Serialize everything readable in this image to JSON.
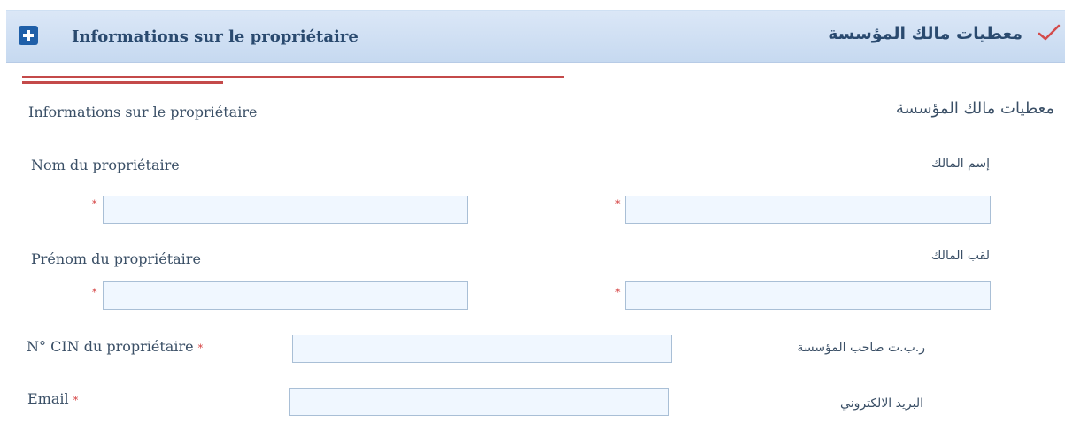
{
  "header": {
    "title_fr": "Informations sur le propriétaire",
    "title_ar": "معطيات مالك المؤسسة",
    "left_icon": "plus-icon",
    "right_icon": "check-icon"
  },
  "section": {
    "title_fr": "Informations sur le propriétaire",
    "title_ar": "معطيات مالك المؤسسة"
  },
  "fields": {
    "owner_name": {
      "label_fr": "Nom du propriétaire",
      "label_ar": "إسم المالك",
      "value_fr": "",
      "value_ar": ""
    },
    "owner_surname": {
      "label_fr": "Prénom du propriétaire",
      "label_ar": "لقب المالك",
      "value_fr": "",
      "value_ar": ""
    },
    "cin": {
      "label_fr": "N° CIN du propriétaire",
      "label_ar": "ر.ب.ت صاحب المؤسسة",
      "value": ""
    },
    "email": {
      "label_fr": "Email",
      "label_ar": "البريد الالكتروني",
      "value": ""
    }
  },
  "required_marker": "*",
  "colors": {
    "header_bg": "#c6d9f0",
    "accent_red": "#c44a4a",
    "field_bg": "#f0f7ff",
    "text": "#3a4f66"
  }
}
